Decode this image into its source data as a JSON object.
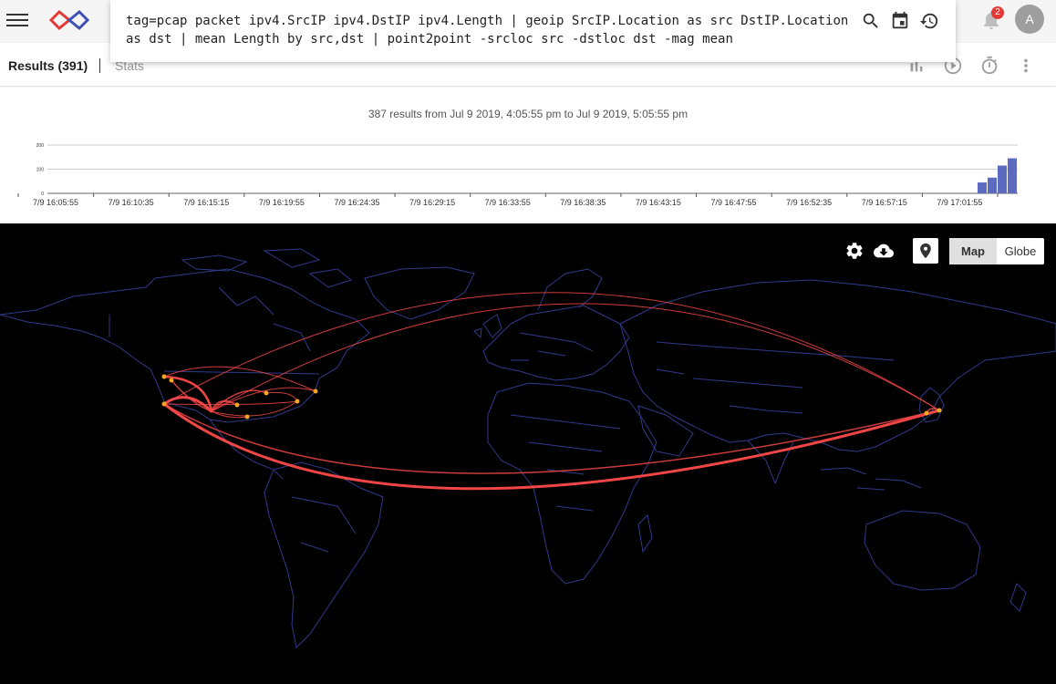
{
  "query": {
    "line1": "tag=pcap packet ipv4.SrcIP ipv4.DstIP ipv4.Length | geoip SrcIP.Location as src DstIP.Location",
    "line2": "as dst | mean Length by src,dst | point2point -srcloc src -dstloc dst -mag mean"
  },
  "notifications": {
    "count": "2"
  },
  "user": {
    "initial": "A"
  },
  "tabs": {
    "results": "Results (391)",
    "stats": "Stats"
  },
  "summary": "387 results from Jul 9 2019, 4:05:55 pm to Jul 9 2019, 5:05:55 pm",
  "map": {
    "map_label": "Map",
    "globe_label": "Globe",
    "active": "Map"
  },
  "colors": {
    "bar": "#5c6bc0",
    "arc": "#ff4a4a",
    "point": "#f5a623",
    "land": "#2f3a8a",
    "accent": "#e53935"
  },
  "chart_data": {
    "type": "bar",
    "title": "",
    "xlabel": "",
    "ylabel": "",
    "ylim": [
      0,
      200
    ],
    "y_ticks": [
      "200",
      "100",
      "0"
    ],
    "x_tick_labels": [
      "7/9 16:05:55",
      "7/9 16:10:35",
      "7/9 16:15:15",
      "7/9 16:19:55",
      "7/9 16:24:35",
      "7/9 16:29:15",
      "7/9 16:33:55",
      "7/9 16:38:35",
      "7/9 16:43:15",
      "7/9 16:47:55",
      "7/9 16:52:35",
      "7/9 16:57:15",
      "7/9 17:01:55"
    ],
    "series": [
      {
        "values": [
          45,
          65,
          115,
          145
        ]
      }
    ]
  }
}
